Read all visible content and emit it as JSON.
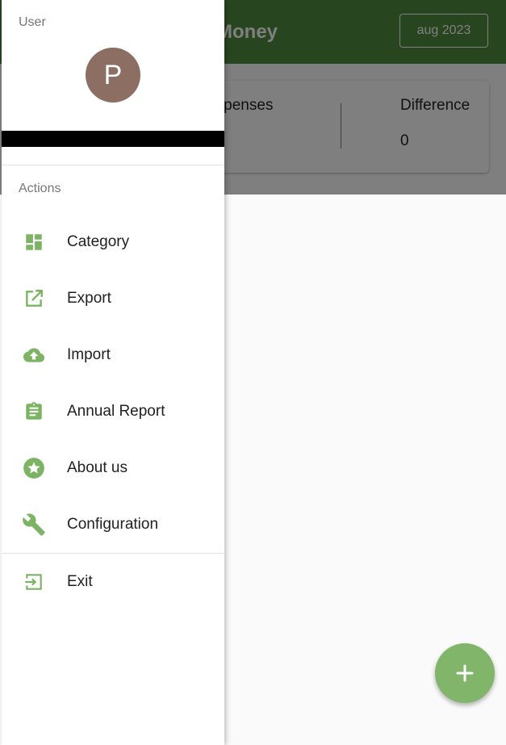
{
  "app": {
    "title": "Money",
    "month_button": "aug 2023",
    "summary": {
      "expenses_label": "Expenses",
      "difference_label": "Difference",
      "difference_value": "0"
    },
    "fab_label": "+"
  },
  "drawer": {
    "user_section_title": "User",
    "avatar_initial": "P",
    "actions_section_title": "Actions",
    "items": [
      {
        "label": "Category",
        "icon": "dashboard-icon"
      },
      {
        "label": "Export",
        "icon": "open-in-new-icon"
      },
      {
        "label": "Import",
        "icon": "cloud-upload-icon"
      },
      {
        "label": "Annual Report",
        "icon": "assignment-icon"
      },
      {
        "label": "About us",
        "icon": "star-circle-icon"
      },
      {
        "label": "Configuration",
        "icon": "wrench-icon"
      }
    ],
    "exit": {
      "label": "Exit",
      "icon": "exit-icon"
    }
  },
  "colors": {
    "primary": "#4f8a3c",
    "accent": "#81b56a",
    "icon": "#7cb463",
    "avatar": "#8d6e63"
  }
}
